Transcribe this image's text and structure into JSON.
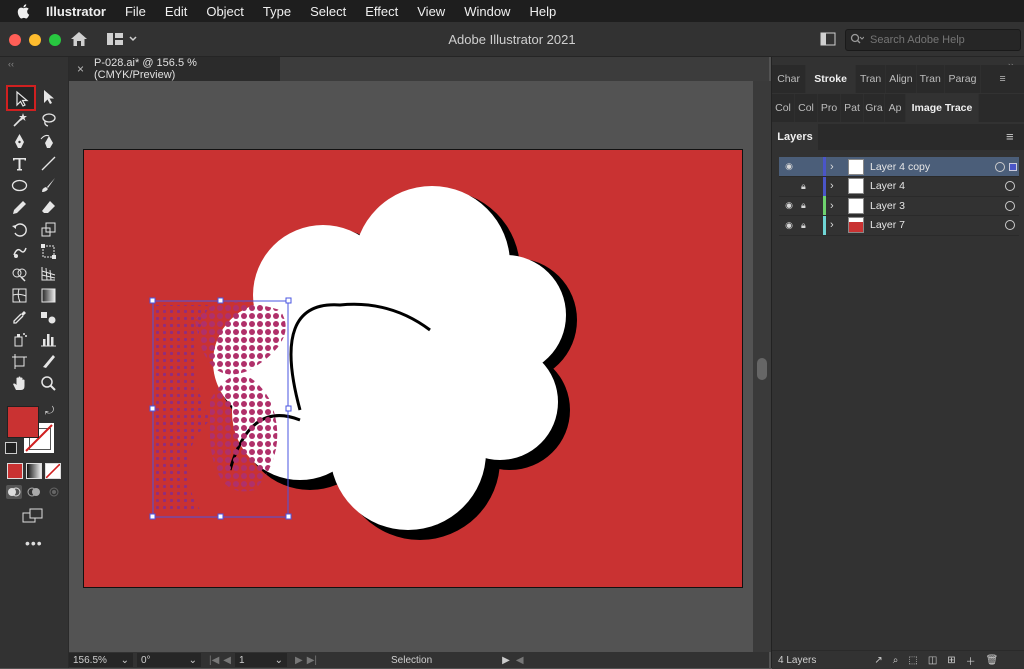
{
  "menubar": {
    "app": "Illustrator",
    "items": [
      "File",
      "Edit",
      "Object",
      "Type",
      "Select",
      "Effect",
      "View",
      "Window",
      "Help"
    ]
  },
  "window": {
    "title": "Adobe Illustrator 2021",
    "search_placeholder": "Search Adobe Help"
  },
  "document": {
    "tab_label": "P-028.ai* @ 156.5 % (CMYK/Preview)"
  },
  "statusbar": {
    "zoom": "156.5%",
    "rotation": "0°",
    "artboard": "1",
    "tool": "Selection"
  },
  "panels": {
    "row1_tabs": [
      "Char",
      "Stroke",
      "Tran",
      "Align",
      "Tran",
      "Parag"
    ],
    "row1_active": "Stroke",
    "row2_tabs": [
      "Col",
      "Col",
      "Pro",
      "Pat",
      "Gra",
      "Ap",
      "Image Trace"
    ],
    "row2_active": "Image Trace",
    "layers_tab": "Layers",
    "layers": [
      {
        "name": "Layer 4 copy",
        "color": "#4a55c8",
        "visible": true,
        "locked": false,
        "selected": true
      },
      {
        "name": "Layer 4",
        "color": "#4a55c8",
        "visible": false,
        "locked": true,
        "selected": false
      },
      {
        "name": "Layer 3",
        "color": "#6ed36e",
        "visible": true,
        "locked": true,
        "selected": false
      },
      {
        "name": "Layer 7",
        "color": "#6fd6d6",
        "visible": true,
        "locked": true,
        "selected": false
      }
    ],
    "layers_count": "4 Layers"
  },
  "colors": {
    "fill": "#c93232",
    "accent": "#4a55c8",
    "selection": "#4b5e79"
  }
}
